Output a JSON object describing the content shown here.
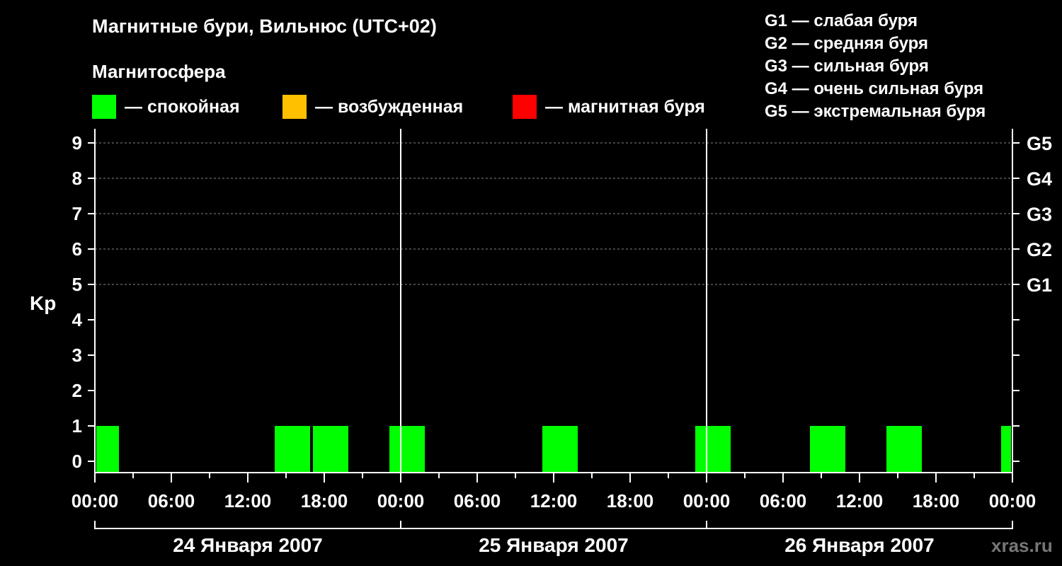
{
  "title": "Магнитные бури, Вильнюс (UTC+02)",
  "magnetosphere_label": "Магнитосфера",
  "legend": [
    {
      "label": "— спокойная",
      "color": "#00ff00"
    },
    {
      "label": "— возбужденная",
      "color": "#ffc000"
    },
    {
      "label": "— магнитная буря",
      "color": "#ff0000"
    }
  ],
  "g_legend": [
    "G1 — слабая буря",
    "G2 — средняя буря",
    "G3 — сильная буря",
    "G4 — очень сильная буря",
    "G5 — экстремальная буря"
  ],
  "watermark": "xras.ru",
  "chart_data": {
    "type": "bar",
    "ylabel": "Kp",
    "ylim": [
      0,
      9
    ],
    "y_ticks": [
      "0",
      "1",
      "2",
      "3",
      "4",
      "5",
      "6",
      "7",
      "8",
      "9"
    ],
    "right_ticks": [
      {
        "kp": 5,
        "label": "G1"
      },
      {
        "kp": 6,
        "label": "G2"
      },
      {
        "kp": 7,
        "label": "G3"
      },
      {
        "kp": 8,
        "label": "G4"
      },
      {
        "kp": 9,
        "label": "G5"
      }
    ],
    "x_tick_labels": [
      "00:00",
      "06:00",
      "12:00",
      "18:00",
      "00:00",
      "06:00",
      "12:00",
      "18:00",
      "00:00",
      "06:00",
      "12:00",
      "18:00",
      "00:00"
    ],
    "days": [
      "24 Января 2007",
      "25 Января 2007",
      "26 Января 2007"
    ],
    "grid": true,
    "series": [
      {
        "color": "#00ff00",
        "bars": [
          {
            "start": "2007-01-24 00:00",
            "end": "2007-01-24 02:00",
            "kp": 1
          },
          {
            "start": "2007-01-24 14:00",
            "end": "2007-01-24 17:00",
            "kp": 1
          },
          {
            "start": "2007-01-24 17:00",
            "end": "2007-01-24 20:00",
            "kp": 1
          },
          {
            "start": "2007-01-24 23:00",
            "end": "2007-01-25 02:00",
            "kp": 1
          },
          {
            "start": "2007-01-25 11:00",
            "end": "2007-01-25 14:00",
            "kp": 1
          },
          {
            "start": "2007-01-25 23:00",
            "end": "2007-01-26 02:00",
            "kp": 1
          },
          {
            "start": "2007-01-26 08:00",
            "end": "2007-01-26 11:00",
            "kp": 1
          },
          {
            "start": "2007-01-26 14:00",
            "end": "2007-01-26 17:00",
            "kp": 1
          },
          {
            "start": "2007-01-26 23:00",
            "end": "2007-01-27 00:00",
            "kp": 1
          }
        ]
      }
    ]
  }
}
